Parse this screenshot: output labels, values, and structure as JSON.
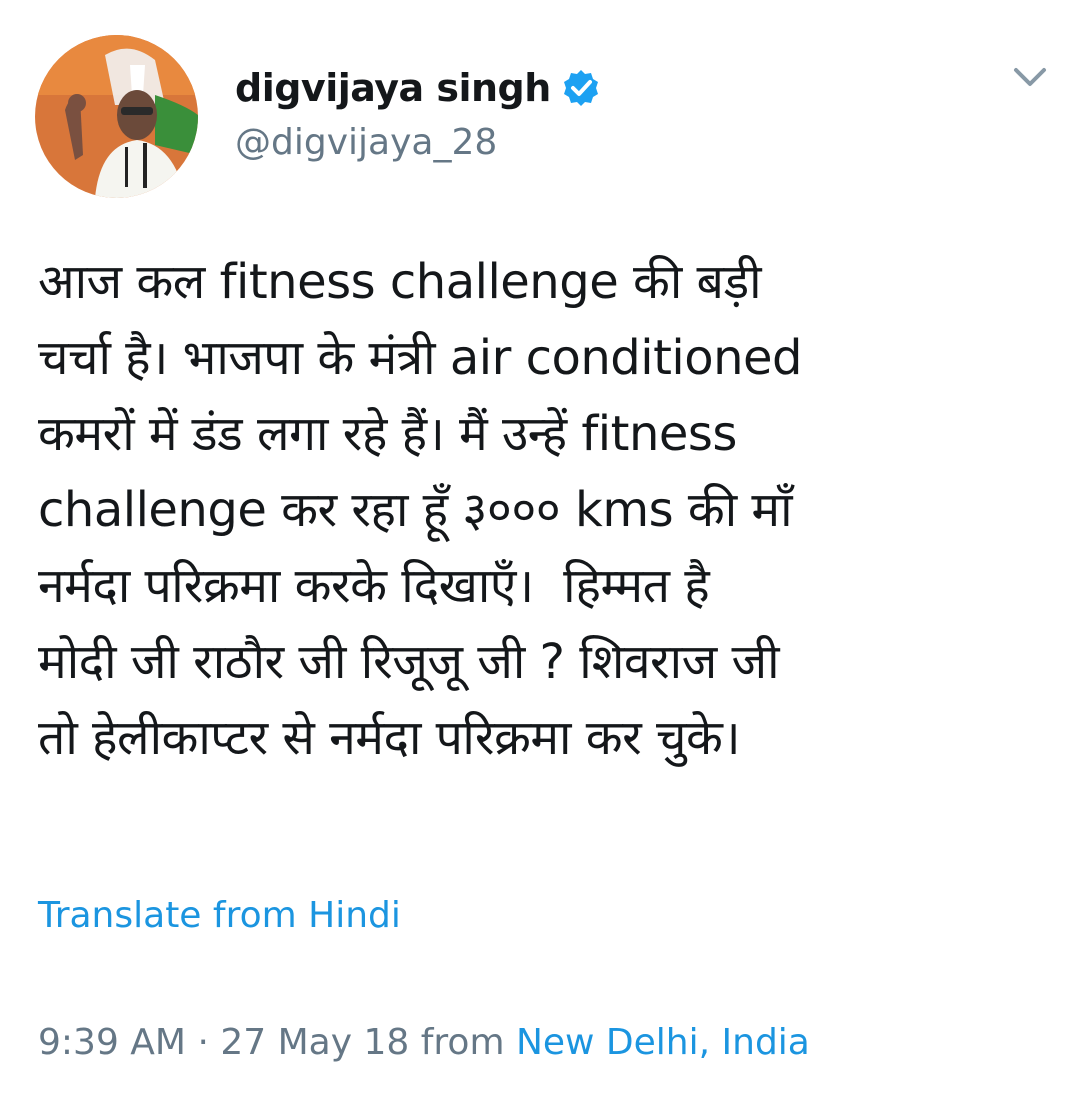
{
  "header": {
    "display_name": "digvijaya singh",
    "handle": "@digvijaya_28",
    "verified": true,
    "verified_icon": "verified-badge-icon",
    "menu_icon": "chevron-down-icon",
    "avatar_icon": "profile-photo"
  },
  "tweet": {
    "text": "आज कल fitness challenge की बड़ी\nचर्चा है। भाजपा के मंत्री air conditioned\nकमरों में डंड लगा रहे हैं। मैं उन्हें fitness\nchallenge कर रहा हूँ ३००० kms की माँ\nनर्मदा परिक्रमा करके दिखाएँ।  हिम्मत है\nमोदी जी राठौर जी रिजूजू जी ? शिवराज जी\nतो हेलीकाप्टर से नर्मदा परिक्रमा कर चुके।",
    "translate_label": "Translate from Hindi"
  },
  "meta": {
    "time": "9:39 AM",
    "separator": "·",
    "date": "27 May 18",
    "from_label": "from",
    "location": "New Delhi, India"
  },
  "colors": {
    "link": "#1b95e0",
    "secondary_text": "#657786",
    "primary_text": "#14171a",
    "verified_badge": "#1da1f2"
  }
}
